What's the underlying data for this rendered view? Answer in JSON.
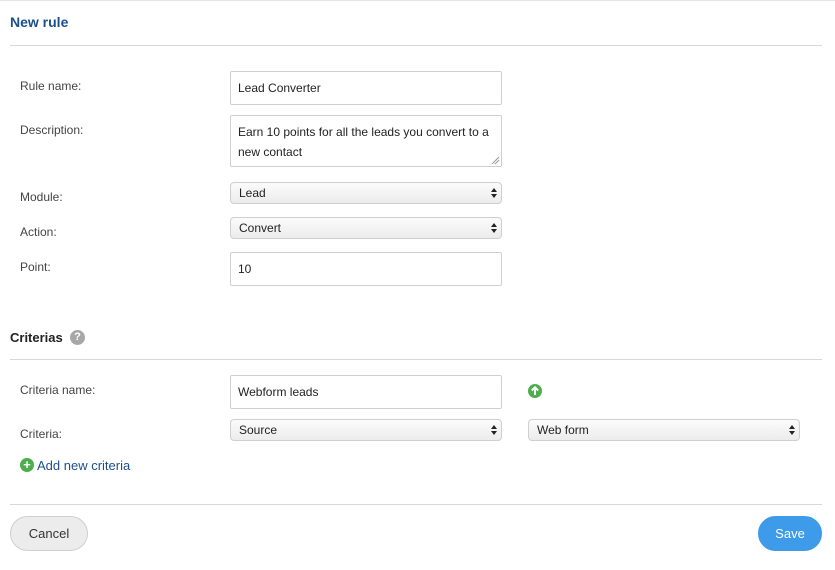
{
  "panel": {
    "title": "New rule"
  },
  "form": {
    "rule_name": {
      "label": "Rule name:",
      "value": "Lead Converter"
    },
    "description": {
      "label": "Description:",
      "value": "Earn 10 points for all the leads you convert to a new contact"
    },
    "module": {
      "label": "Module:",
      "value": "Lead"
    },
    "action": {
      "label": "Action:",
      "value": "Convert"
    },
    "point": {
      "label": "Point:",
      "value": "10"
    }
  },
  "criterias": {
    "title": "Criterias",
    "help_icon": "question-circle-icon",
    "help_glyph": "?",
    "criteria_name": {
      "label": "Criteria name:",
      "value": "Webform leads"
    },
    "criteria": {
      "label": "Criteria:",
      "field": "Source",
      "value": "Web form"
    },
    "add_label": "Add new criteria",
    "add_glyph": "+"
  },
  "buttons": {
    "cancel": "Cancel",
    "save": "Save"
  },
  "colors": {
    "title": "#1b4f8c",
    "link": "#1b4f8c",
    "save": "#3d9be9",
    "icon_green": "#4cae4c",
    "help_gray": "#a7a7a7"
  }
}
